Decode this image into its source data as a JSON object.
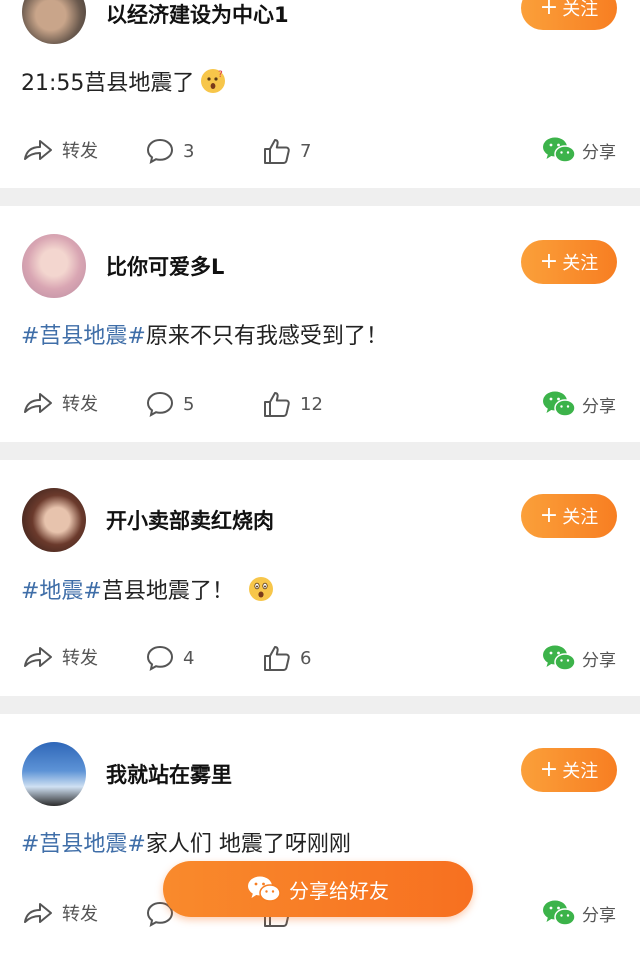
{
  "follow_label": "关注",
  "repost_label": "转发",
  "share_label": "分享",
  "floating_share_label": "分享给好友",
  "colors": {
    "accent": "#f77e22",
    "hashtag": "#3f6ea8",
    "wechat": "#3cb34a"
  },
  "posts": [
    {
      "username": "以经济建设为中心1",
      "content_text": "21:55莒县地震了",
      "hashtags": [],
      "emoji": "surprised-face",
      "comments": "3",
      "likes": "7"
    },
    {
      "username": "比你可爱多L",
      "hashtag": "#莒县地震#",
      "content_text": "原来不只有我感受到了！",
      "comments": "5",
      "likes": "12"
    },
    {
      "username": "开小卖部卖红烧肉",
      "hashtag": "#地震#",
      "content_text": "莒县地震了！",
      "emoji": "astonished-face",
      "comments": "4",
      "likes": "6"
    },
    {
      "username": "我就站在雾里",
      "hashtag": "#莒县地震#",
      "content_text": "家人们 地震了呀刚刚"
    }
  ]
}
